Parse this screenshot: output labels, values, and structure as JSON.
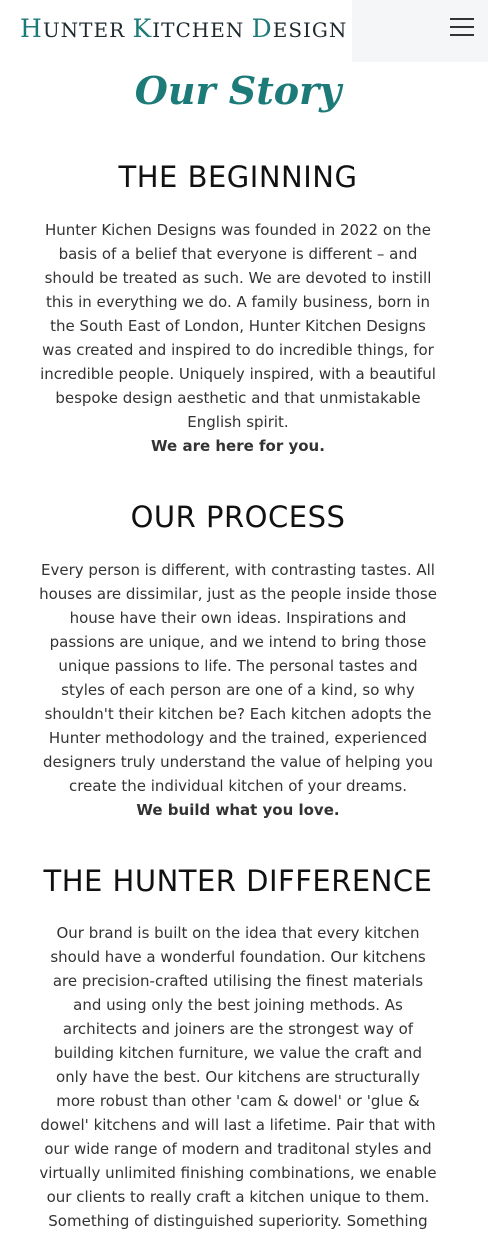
{
  "header": {
    "logo_parts": [
      "H",
      "UNTER ",
      "K",
      "ITCHEN ",
      "D",
      "ESIGN"
    ],
    "menu_icon": "hamburger-menu-icon"
  },
  "page": {
    "title": "Our Story"
  },
  "sections": [
    {
      "heading": "THE BEGINNING",
      "body": "Hunter Kichen Designs was founded in 2022 on the basis of a belief that everyone is different – and should be treated as such. We are devoted to instill this in everything we do. A family business, born in the South East of London, Hunter Kitchen Designs was created and inspired to do incredible things, for incredible people. Uniquely inspired, with a beautiful bespoke design aesthetic and that unmistakable English spirit.",
      "tagline": "We are here for you."
    },
    {
      "heading": "OUR PROCESS",
      "body": "Every person is different, with contrasting tastes. All houses are dissimilar, just as the people inside those house have their own ideas. Inspirations and passions are unique, and we intend to bring those unique passions to life. The personal tastes and styles of each person are one of a kind, so why shouldn't their kitchen be? Each kitchen adopts the Hunter methodology and the trained, experienced designers truly understand the value of helping you create the individual kitchen of your dreams.",
      "tagline": "We build what you love."
    },
    {
      "heading": "THE HUNTER DIFFERENCE",
      "body": "Our brand is built on the idea that every kitchen should have a wonderful foundation. Our kitchens are precision-crafted utilising the finest materials and using only the best joining methods. As architects and joiners are the strongest way of building kitchen furniture, we value the craft and only have the best. Our kitchens are structurally more robust than other 'cam & dowel' or 'glue & dowel' kitchens and will last a lifetime. Pair that with our wide range of modern and traditonal styles and virtually unlimited finishing combinations, we enable our clients to really craft a kitchen unique to them. Something of distinguished superiority. Something"
    }
  ],
  "colors": {
    "accent": "#1c7a78",
    "text": "#333333",
    "heading": "#111111",
    "menu_background": "#f5f6f7"
  }
}
